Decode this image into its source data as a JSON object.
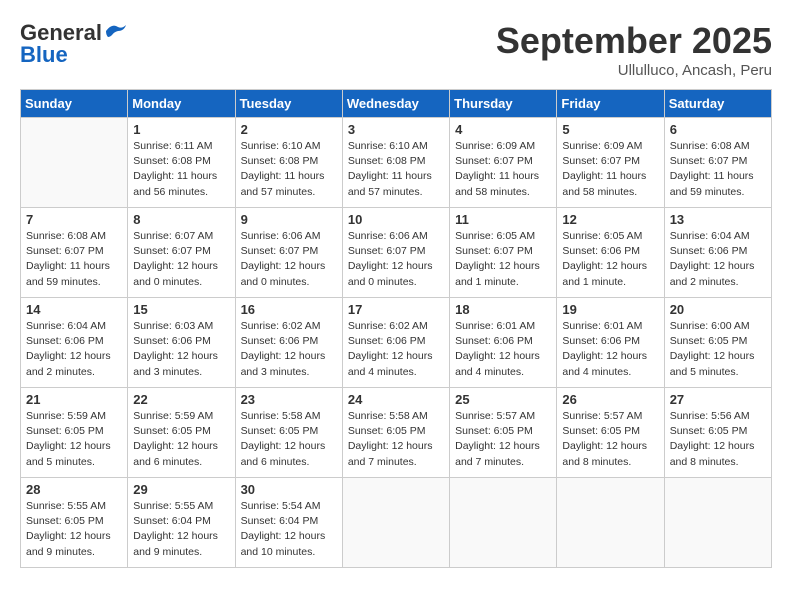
{
  "logo": {
    "general": "General",
    "blue": "Blue"
  },
  "header": {
    "month": "September 2025",
    "location": "Ullulluco, Ancash, Peru"
  },
  "weekdays": [
    "Sunday",
    "Monday",
    "Tuesday",
    "Wednesday",
    "Thursday",
    "Friday",
    "Saturday"
  ],
  "weeks": [
    [
      {
        "day": "",
        "info": ""
      },
      {
        "day": "1",
        "info": "Sunrise: 6:11 AM\nSunset: 6:08 PM\nDaylight: 11 hours\nand 56 minutes."
      },
      {
        "day": "2",
        "info": "Sunrise: 6:10 AM\nSunset: 6:08 PM\nDaylight: 11 hours\nand 57 minutes."
      },
      {
        "day": "3",
        "info": "Sunrise: 6:10 AM\nSunset: 6:08 PM\nDaylight: 11 hours\nand 57 minutes."
      },
      {
        "day": "4",
        "info": "Sunrise: 6:09 AM\nSunset: 6:07 PM\nDaylight: 11 hours\nand 58 minutes."
      },
      {
        "day": "5",
        "info": "Sunrise: 6:09 AM\nSunset: 6:07 PM\nDaylight: 11 hours\nand 58 minutes."
      },
      {
        "day": "6",
        "info": "Sunrise: 6:08 AM\nSunset: 6:07 PM\nDaylight: 11 hours\nand 59 minutes."
      }
    ],
    [
      {
        "day": "7",
        "info": "Sunrise: 6:08 AM\nSunset: 6:07 PM\nDaylight: 11 hours\nand 59 minutes."
      },
      {
        "day": "8",
        "info": "Sunrise: 6:07 AM\nSunset: 6:07 PM\nDaylight: 12 hours\nand 0 minutes."
      },
      {
        "day": "9",
        "info": "Sunrise: 6:06 AM\nSunset: 6:07 PM\nDaylight: 12 hours\nand 0 minutes."
      },
      {
        "day": "10",
        "info": "Sunrise: 6:06 AM\nSunset: 6:07 PM\nDaylight: 12 hours\nand 0 minutes."
      },
      {
        "day": "11",
        "info": "Sunrise: 6:05 AM\nSunset: 6:07 PM\nDaylight: 12 hours\nand 1 minute."
      },
      {
        "day": "12",
        "info": "Sunrise: 6:05 AM\nSunset: 6:06 PM\nDaylight: 12 hours\nand 1 minute."
      },
      {
        "day": "13",
        "info": "Sunrise: 6:04 AM\nSunset: 6:06 PM\nDaylight: 12 hours\nand 2 minutes."
      }
    ],
    [
      {
        "day": "14",
        "info": "Sunrise: 6:04 AM\nSunset: 6:06 PM\nDaylight: 12 hours\nand 2 minutes."
      },
      {
        "day": "15",
        "info": "Sunrise: 6:03 AM\nSunset: 6:06 PM\nDaylight: 12 hours\nand 3 minutes."
      },
      {
        "day": "16",
        "info": "Sunrise: 6:02 AM\nSunset: 6:06 PM\nDaylight: 12 hours\nand 3 minutes."
      },
      {
        "day": "17",
        "info": "Sunrise: 6:02 AM\nSunset: 6:06 PM\nDaylight: 12 hours\nand 4 minutes."
      },
      {
        "day": "18",
        "info": "Sunrise: 6:01 AM\nSunset: 6:06 PM\nDaylight: 12 hours\nand 4 minutes."
      },
      {
        "day": "19",
        "info": "Sunrise: 6:01 AM\nSunset: 6:06 PM\nDaylight: 12 hours\nand 4 minutes."
      },
      {
        "day": "20",
        "info": "Sunrise: 6:00 AM\nSunset: 6:05 PM\nDaylight: 12 hours\nand 5 minutes."
      }
    ],
    [
      {
        "day": "21",
        "info": "Sunrise: 5:59 AM\nSunset: 6:05 PM\nDaylight: 12 hours\nand 5 minutes."
      },
      {
        "day": "22",
        "info": "Sunrise: 5:59 AM\nSunset: 6:05 PM\nDaylight: 12 hours\nand 6 minutes."
      },
      {
        "day": "23",
        "info": "Sunrise: 5:58 AM\nSunset: 6:05 PM\nDaylight: 12 hours\nand 6 minutes."
      },
      {
        "day": "24",
        "info": "Sunrise: 5:58 AM\nSunset: 6:05 PM\nDaylight: 12 hours\nand 7 minutes."
      },
      {
        "day": "25",
        "info": "Sunrise: 5:57 AM\nSunset: 6:05 PM\nDaylight: 12 hours\nand 7 minutes."
      },
      {
        "day": "26",
        "info": "Sunrise: 5:57 AM\nSunset: 6:05 PM\nDaylight: 12 hours\nand 8 minutes."
      },
      {
        "day": "27",
        "info": "Sunrise: 5:56 AM\nSunset: 6:05 PM\nDaylight: 12 hours\nand 8 minutes."
      }
    ],
    [
      {
        "day": "28",
        "info": "Sunrise: 5:55 AM\nSunset: 6:05 PM\nDaylight: 12 hours\nand 9 minutes."
      },
      {
        "day": "29",
        "info": "Sunrise: 5:55 AM\nSunset: 6:04 PM\nDaylight: 12 hours\nand 9 minutes."
      },
      {
        "day": "30",
        "info": "Sunrise: 5:54 AM\nSunset: 6:04 PM\nDaylight: 12 hours\nand 10 minutes."
      },
      {
        "day": "",
        "info": ""
      },
      {
        "day": "",
        "info": ""
      },
      {
        "day": "",
        "info": ""
      },
      {
        "day": "",
        "info": ""
      }
    ]
  ]
}
